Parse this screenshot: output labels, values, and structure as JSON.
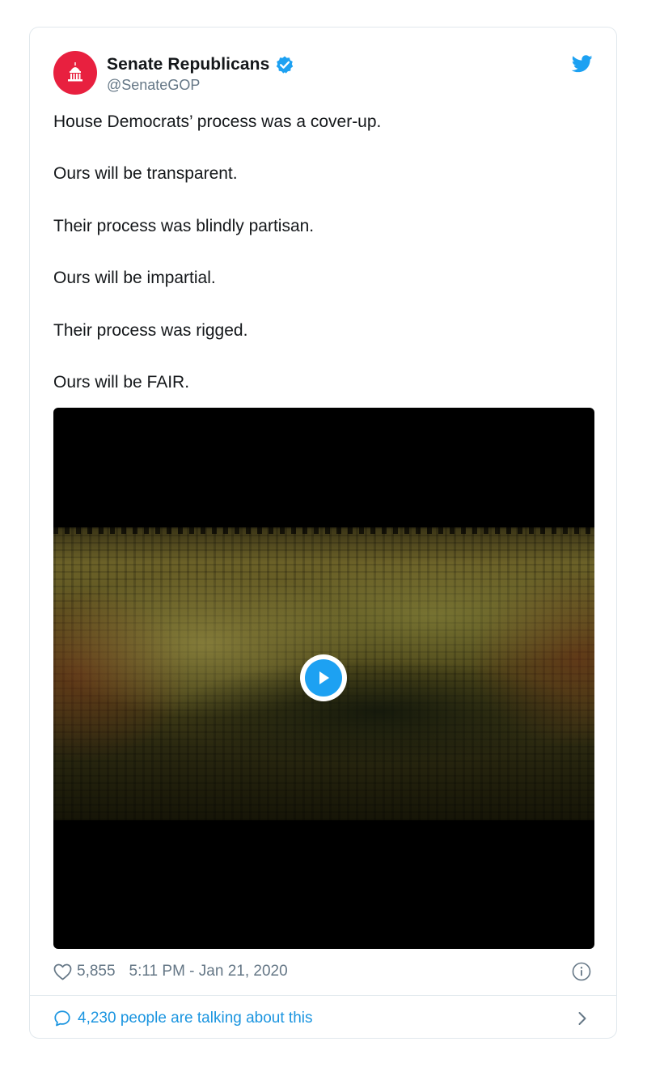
{
  "author": {
    "display_name": "Senate Republicans",
    "handle": "@SenateGOP",
    "verified": true,
    "avatar_color": "#e8203f"
  },
  "tweet": {
    "lines": [
      "House Democrats’ process was a cover-up.",
      "Ours will be transparent.",
      "Their process was blindly partisan.",
      "Ours will be impartial.",
      "Their process was rigged.",
      "Ours will be FAIR."
    ]
  },
  "media": {
    "type": "video",
    "play_icon": "play-icon"
  },
  "footer": {
    "like_count": "5,855",
    "timestamp": "5:11 PM - Jan 21, 2020"
  },
  "conversation": {
    "text": "4,230 people are talking about this"
  },
  "colors": {
    "twitter_blue": "#1da1f2",
    "link_blue": "#1b95e0",
    "text_primary": "#14171a",
    "text_secondary": "#657786",
    "border": "#e1e8ed"
  },
  "icons": {
    "avatar": "capitol-icon",
    "verified": "verified-badge-icon",
    "brand": "twitter-bird-icon",
    "like": "heart-icon",
    "info": "info-icon",
    "conversation": "speech-bubble-icon",
    "chevron": "chevron-right-icon"
  }
}
